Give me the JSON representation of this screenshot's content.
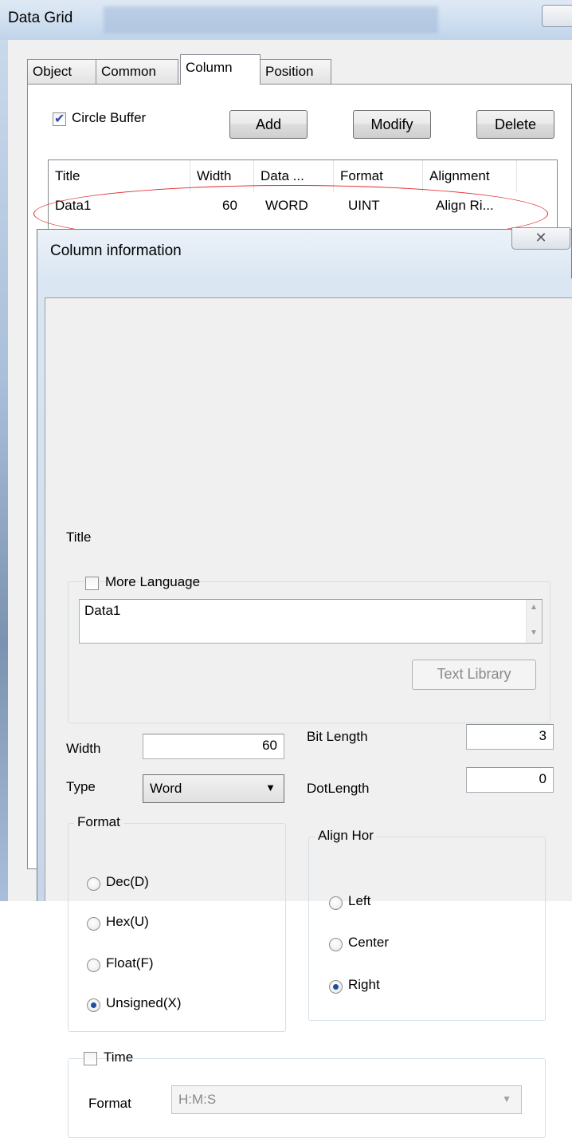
{
  "outer": {
    "title": "Data Grid",
    "tabs": [
      "Object",
      "Common",
      "Column",
      "Position"
    ],
    "active_tab": "Column",
    "circle_buffer_label": "Circle Buffer",
    "circle_buffer_checked": true,
    "buttons": {
      "add": "Add",
      "modify": "Modify",
      "delete": "Delete"
    },
    "list": {
      "headers": [
        "Title",
        "Width",
        "Data ...",
        "Format",
        "Alignment"
      ],
      "rows": [
        {
          "title": "Data1",
          "width": "60",
          "data": "WORD",
          "format": "UINT",
          "alignment": "Align Ri..."
        }
      ]
    },
    "highlight_color": "#e0262a"
  },
  "dialog": {
    "title": "Column information",
    "close_glyph": "✕",
    "title_section_label": "Title",
    "more_language_label": "More Language",
    "more_language_checked": false,
    "title_text": "Data1",
    "text_library_label": "Text Library",
    "width_label": "Width",
    "width_value": "60",
    "bit_length_label": "Bit Length",
    "bit_length_value": "3",
    "type_label": "Type",
    "type_value": "Word",
    "dot_length_label": "DotLength",
    "dot_length_value": "0",
    "format_group_label": "Format",
    "format_options": [
      "Dec(D)",
      "Hex(U)",
      "Float(F)",
      "Unsigned(X)"
    ],
    "format_selected": "Unsigned(X)",
    "align_group_label": "Align Hor",
    "align_options": [
      "Left",
      "Center",
      "Right"
    ],
    "align_selected": "Right",
    "time_label": "Time",
    "time_checked": false,
    "time_format_label": "Format",
    "time_format_value": "H:M:S"
  }
}
